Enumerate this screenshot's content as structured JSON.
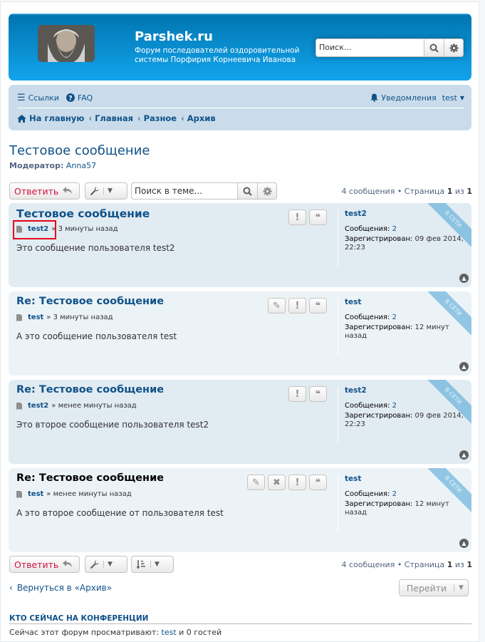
{
  "header": {
    "site_title": "Parshek.ru",
    "site_desc": "Форум последователей оздоровительной системы Порфирия Корнеевича Иванова",
    "search_value": "Поиск..."
  },
  "nav": {
    "links": "Ссылки",
    "faq": "FAQ",
    "notifications": "Уведомления",
    "user": "test",
    "crumbs": [
      "На главную",
      "Главная",
      "Разное",
      "Архив"
    ]
  },
  "topic": {
    "title": "Тестовое сообщение",
    "moderator_label": "Модератор:",
    "moderator": "Anna57"
  },
  "actionbar": {
    "reply": "Ответить",
    "search_value": "Поиск в теме...",
    "page_info_a": "4 сообщения • Страница ",
    "page_cur": "1",
    "page_of": " из ",
    "page_total": "1"
  },
  "posts": [
    {
      "title": "Тестовое сообщение",
      "author": "test2",
      "time": "» 3 минуты назад",
      "content": "Это сообщение пользователя test2",
      "profile_name": "test2",
      "posts_label": "Сообщения:",
      "posts_val": "2",
      "reg_label": "Зарегистрирован:",
      "reg_val": "09 фев 2014, 22:23",
      "online": "В СЕТИ"
    },
    {
      "title": "Re: Тестовое сообщение",
      "author": "test",
      "time": "» 3 минуты назад",
      "content": "А это сообщение пользователя test",
      "profile_name": "test",
      "posts_label": "Сообщения:",
      "posts_val": "2",
      "reg_label": "Зарегистрирован:",
      "reg_val": "12 минут назад",
      "online": "В СЕТИ"
    },
    {
      "title": "Re: Тестовое сообщение",
      "author": "test2",
      "time": "» менее минуты назад",
      "content": "Это второе сообщение пользователя test2",
      "profile_name": "test2",
      "posts_label": "Сообщения:",
      "posts_val": "2",
      "reg_label": "Зарегистрирован:",
      "reg_val": "09 фев 2014, 22:23",
      "online": "В СЕТИ"
    },
    {
      "title": "Re: Тестовое сообщение",
      "author": "test",
      "time": "» менее минуты назад",
      "content": "А это второе сообщение от пользователя test",
      "profile_name": "test",
      "posts_label": "Сообщения:",
      "posts_val": "2",
      "reg_label": "Зарегистрирован:",
      "reg_val": "12 минут назад",
      "online": "В СЕТИ"
    }
  ],
  "footer": {
    "back": "Вернуться в «Архив»",
    "goto": "Перейти",
    "online_heading": "КТО СЕЙЧАС НА КОНФЕРЕНЦИИ",
    "online_text_a": "Сейчас этот форум просматривают: ",
    "online_user": "test",
    "online_text_b": " и 0 гостей"
  },
  "colors": {
    "header_blue": "#12a3eb",
    "link_blue": "#105289",
    "reply_red": "#d31141",
    "highlight": "#e2001a"
  }
}
